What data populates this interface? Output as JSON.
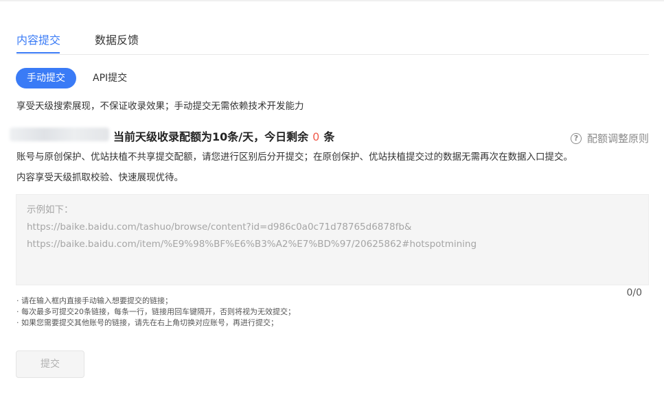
{
  "tabs": [
    {
      "label": "内容提交",
      "active": true
    },
    {
      "label": "数据反馈",
      "active": false
    }
  ],
  "subtabs": [
    {
      "label": "手动提交",
      "active": true
    },
    {
      "label": "API提交",
      "active": false
    }
  ],
  "intro_text": "享受天级搜索展现，不保证收录效果；手动提交无需依赖技术开发能力",
  "quota": {
    "prefix": "当前天级收录配额为10条/天，今日剩余",
    "remaining": "0",
    "suffix": "条"
  },
  "help_link": {
    "icon": "question-circle-icon",
    "label": "配额调整原则"
  },
  "notice_1": "账号与原创保护、优站扶植不共享提交配额，请您进行区别后分开提交；在原创保护、优站扶植提交过的数据无需再次在数据入口提交。",
  "notice_2": "内容享受天级抓取校验、快速展现优待。",
  "textarea": {
    "placeholder_lines": [
      "示例如下：",
      "https://baike.baidu.com/tashuo/browse/content?id=d986c0a0c71d78765d6878fb&",
      "https://baike.baidu.com/item/%E9%98%BF%E6%B3%A2%E7%BD%97/20625862#hotspotmining"
    ],
    "counter": "0/0"
  },
  "notes": [
    "· 请在输入框内直接手动输入想要提交的链接；",
    "· 每次最多可提交20条链接，每条一行，链接用回车键隔开，否则将视为无效提交；",
    "· 如果您需要提交其他账号的链接，请先在右上角切换对应账号，再进行提交；"
  ],
  "submit_label": "提交",
  "colors": {
    "accent": "#3a7bf6",
    "remaining": "#f15c4d"
  }
}
